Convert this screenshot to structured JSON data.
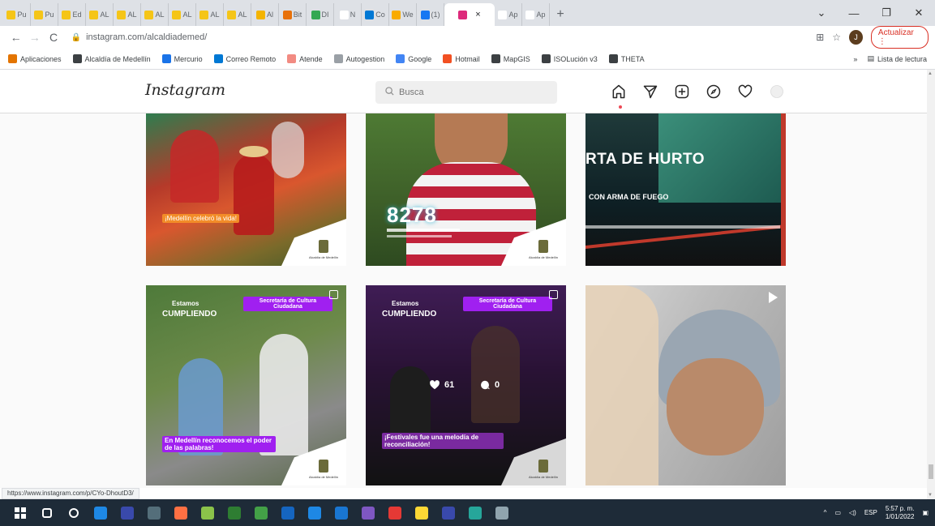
{
  "browser": {
    "tabs": [
      {
        "label": "Pu",
        "color": "#f5c518"
      },
      {
        "label": "Pu",
        "color": "#f5c518"
      },
      {
        "label": "Ed",
        "color": "#f5c518"
      },
      {
        "label": "AL",
        "color": "#f5c518"
      },
      {
        "label": "AL",
        "color": "#f5c518"
      },
      {
        "label": "AL",
        "color": "#f5c518"
      },
      {
        "label": "AL",
        "color": "#f5c518"
      },
      {
        "label": "AL",
        "color": "#f5c518"
      },
      {
        "label": "AL",
        "color": "#f5c518"
      },
      {
        "label": "Al",
        "color": "#f4b400"
      },
      {
        "label": "Bit",
        "color": "#e8710a"
      },
      {
        "label": "DI",
        "color": "#34a853"
      },
      {
        "label": "N",
        "color": "#ffffff"
      },
      {
        "label": "Co",
        "color": "#0078d4"
      },
      {
        "label": "We",
        "color": "#f9ab00"
      },
      {
        "label": "(1)",
        "color": "#1877f2"
      },
      {
        "label": "",
        "color": "#dd2a7b",
        "active": true
      },
      {
        "label": "Ap",
        "color": "#ffffff"
      },
      {
        "label": "Ap",
        "color": "#ffffff"
      }
    ],
    "url": "instagram.com/alcaldiademed/",
    "update_label": "Actualizar",
    "profile_initial": "J",
    "bookmarks": [
      {
        "label": "Aplicaciones",
        "color": "#e37400"
      },
      {
        "label": "Alcaldía de Medellín",
        "color": "#3c4043"
      },
      {
        "label": "Mercurio",
        "color": "#1a73e8"
      },
      {
        "label": "Correo Remoto",
        "color": "#0078d4"
      },
      {
        "label": "Atende",
        "color": "#f28b82"
      },
      {
        "label": "Autogestion",
        "color": "#9aa0a6"
      },
      {
        "label": "Google",
        "color": "#4285f4"
      },
      {
        "label": "Hotmail",
        "color": "#f25022"
      },
      {
        "label": "MapGIS",
        "color": "#3c4043"
      },
      {
        "label": "ISOLución v3",
        "color": "#3c4043"
      },
      {
        "label": "THETA",
        "color": "#3c4043"
      }
    ],
    "reading_list": "Lista de lectura",
    "status_url": "https://www.instagram.com/p/CYo-DhoutD3/"
  },
  "instagram": {
    "logo": "Instagram",
    "search_placeholder": "Busca"
  },
  "posts": [
    {
      "caption": "¡Medellín celebró la vida!",
      "cap_color": "#f28c28",
      "footer": "Alcaldía de Medellín"
    },
    {
      "big_number": "8278",
      "footer": "Alcaldía de Medellín"
    },
    {
      "title": "RTA DE HURTO",
      "subtitle": "CON ARMA DE FUEGO"
    },
    {
      "tag1": "Estamos",
      "tag2": "CUMPLIENDO",
      "badge": "Secretaría de Cultura Ciudadana",
      "caption": "En Medellín reconocemos el poder de las palabras!",
      "cap_color": "#a020f0",
      "footer": "Alcaldía de Medellín"
    },
    {
      "tag1": "Estamos",
      "tag2": "CUMPLIENDO",
      "badge": "Secretaría de Cultura Ciudadana",
      "likes": "61",
      "comments": "0",
      "caption": "¡Festivales fue una melodía de reconciliación!",
      "cap_color": "#a020f0",
      "footer": "Alcaldía de Medellín"
    },
    {
      "video": true
    }
  ],
  "taskbar": {
    "apps": [
      "#ffffff",
      "#ffffff",
      "#ffffff",
      "#1e88e5",
      "#3949ab",
      "#546e7a",
      "#ff7043",
      "#8bc34a",
      "#2e7d32",
      "#43a047",
      "#1565c0",
      "#1e88e5",
      "#1976d2",
      "#7e57c2",
      "#e53935",
      "#fdd835",
      "#3949ab",
      "#26a69a",
      "#90a4ae"
    ],
    "time": "5:57 p. m.",
    "date": "1/01/2022",
    "lang": "ESP"
  }
}
